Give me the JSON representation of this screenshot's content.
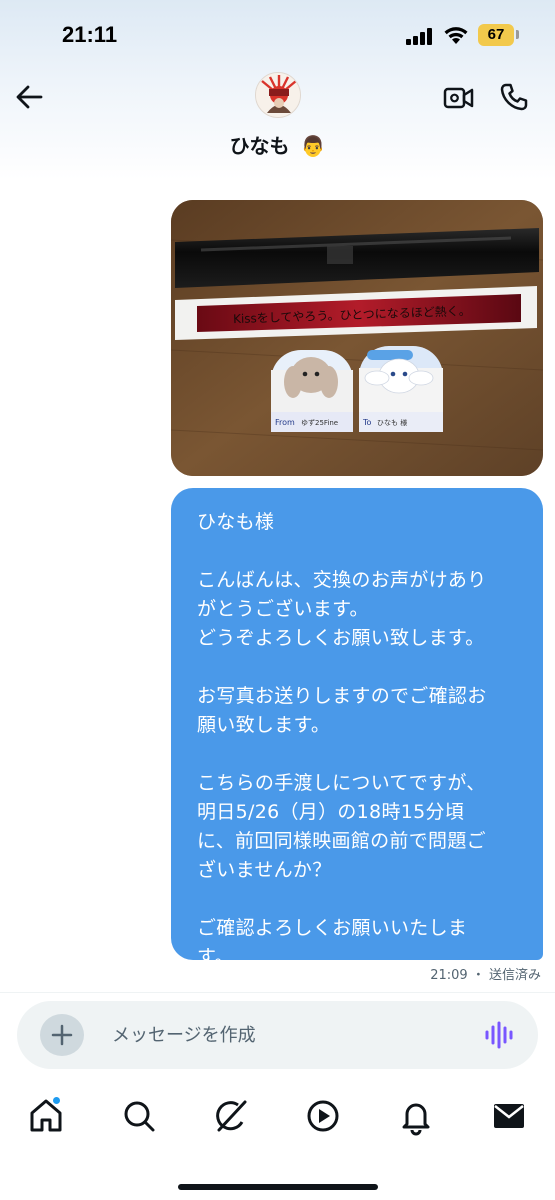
{
  "status_bar": {
    "time": "21:11",
    "battery_level": "67",
    "battery_color": "#f2c94c"
  },
  "header": {
    "contact_name": "ひなも",
    "contact_emoji": "👨",
    "icons": {
      "back": "arrow-left-icon",
      "video": "video-camera-icon",
      "phone": "phone-icon"
    }
  },
  "photo_message": {
    "card_left_from_label": "From",
    "card_left_from_name": "ゆず25Fine",
    "card_right_to_label": "To",
    "card_right_to_name": "ひなも 様",
    "ribbon_text": "Kissをしてやろう。ひとつになるほど熱く。"
  },
  "message": {
    "lines": [
      "ひなも様",
      "",
      "こんばんは、交換のお声がけあり",
      "がとうございます。",
      "どうぞよろしくお願い致します。",
      "",
      "お写真お送りしますのでご確認お",
      "願い致します。",
      "",
      "こちらの手渡しについてですが、",
      "明日5/26（月）の18時15分頃",
      "に、前回同様映画館の前で問題ご",
      "ざいませんか？",
      "",
      "ご確認よろしくお願いいたしま",
      "す。"
    ],
    "bubble_color": "#4a99e9",
    "timestamp": "21:09",
    "status": "送信済み"
  },
  "composer": {
    "placeholder": "メッセージを作成",
    "value": ""
  },
  "bottom_nav": {
    "items": [
      "home-icon",
      "search-icon",
      "grok-icon",
      "play-icon",
      "bell-icon",
      "mail-icon"
    ],
    "accent": "#1d9bf0"
  }
}
